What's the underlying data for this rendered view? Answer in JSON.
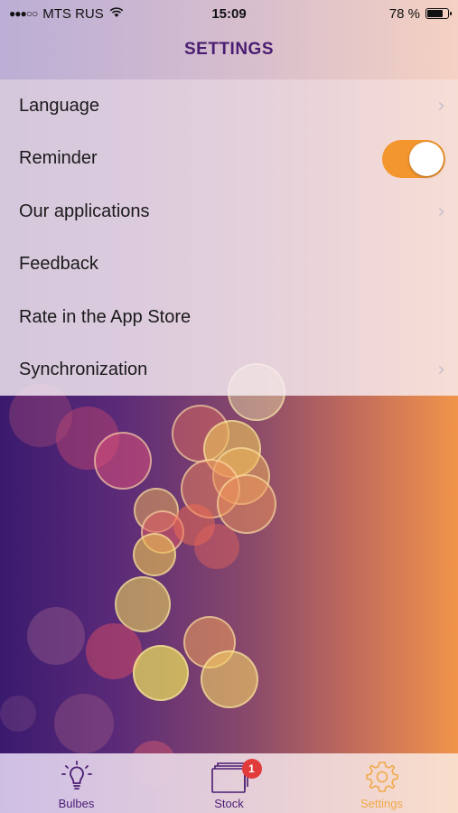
{
  "status_bar": {
    "signal": "●●●○○",
    "carrier": "MTS RUS",
    "time": "15:09",
    "battery": "78 %",
    "battery_level": 0.78
  },
  "header": {
    "title": "SETTINGS"
  },
  "settings": [
    {
      "label": "Language",
      "accessory": "chevron"
    },
    {
      "label": "Reminder",
      "accessory": "toggle",
      "toggle_on": true
    },
    {
      "label": "Our applications",
      "accessory": "chevron"
    },
    {
      "label": "Feedback",
      "accessory": "none"
    },
    {
      "label": "Rate in the App Store",
      "accessory": "none"
    },
    {
      "label": "Synchronization",
      "accessory": "chevron"
    }
  ],
  "chevron_glyph": "›",
  "tab_bar": {
    "tabs": [
      {
        "label": "Bulbes",
        "icon": "bulb-icon",
        "active": false
      },
      {
        "label": "Stock",
        "icon": "stock-icon",
        "active": false,
        "badge": "1"
      },
      {
        "label": "Settings",
        "icon": "gear-icon",
        "active": true
      }
    ]
  },
  "colors": {
    "accent": "#f3962e",
    "title": "#4a1d72",
    "active_tab": "#f0a94a",
    "badge": "#e23b3b"
  }
}
